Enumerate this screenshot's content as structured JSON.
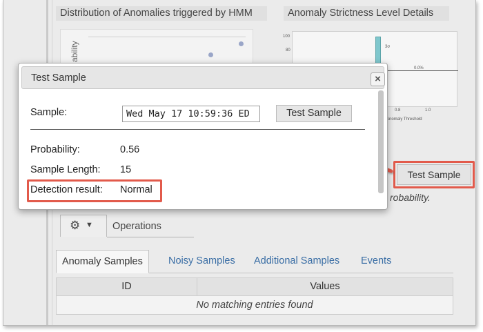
{
  "panels": {
    "hmm_title": "Distribution of Anomalies triggered by HMM",
    "hmm_ylabel": "ability",
    "strictness_title": "Anomaly Strictness Level Details",
    "strict_ticks": {
      "y100": "100",
      "y80": "80",
      "x08": "0.8",
      "x10": "1.0",
      "pct": "0.0%",
      "sigma": "3σ",
      "xlabel": "Anomaly Threshold"
    }
  },
  "background": {
    "test_sample_label": "Test Sample",
    "probability_note": "robability."
  },
  "operations": {
    "label": "Operations",
    "gear_icon": "gear-icon",
    "caret_icon": "caret-down-icon"
  },
  "tabs": [
    {
      "label": "Anomaly Samples",
      "active": true
    },
    {
      "label": "Noisy Samples",
      "active": false
    },
    {
      "label": "Additional Samples",
      "active": false
    },
    {
      "label": "Events",
      "active": false
    }
  ],
  "table": {
    "columns": [
      "ID",
      "Values"
    ],
    "empty_message": "No matching entries found"
  },
  "dialog": {
    "title": "Test Sample",
    "close_glyph": "×",
    "sample_label": "Sample:",
    "sample_value": "Wed May 17 10:59:36 ED",
    "test_button": "Test Sample",
    "probability_label": "Probability:",
    "probability_value": "0.56",
    "length_label": "Sample Length:",
    "length_value": "15",
    "detection_label": "Detection result:",
    "detection_value": "Normal"
  },
  "colors": {
    "highlight": "#e25a4b",
    "link": "#3a6ea5"
  }
}
